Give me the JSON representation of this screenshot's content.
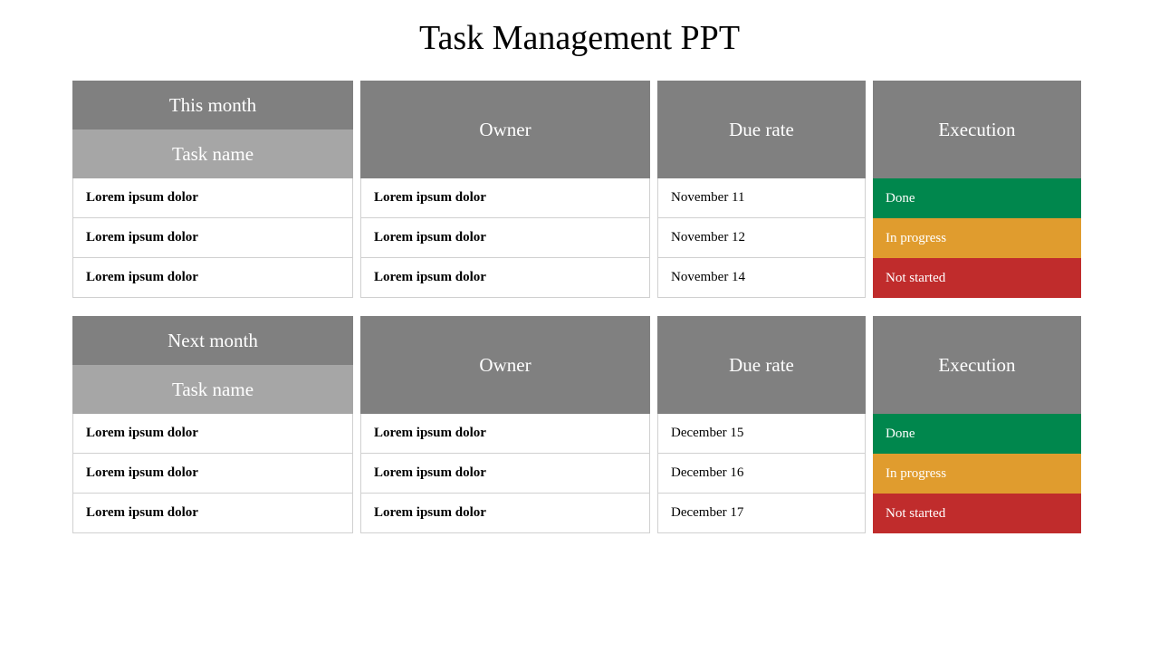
{
  "title": "Task Management PPT",
  "sections": [
    {
      "month_label": "This month",
      "taskname_label": "Task name",
      "owner_label": "Owner",
      "due_label": "Due rate",
      "exec_label": "Execution",
      "rows": [
        {
          "task": "Lorem ipsum dolor",
          "owner": "Lorem ipsum dolor",
          "due": "November 11",
          "status": "Done",
          "status_class": "done"
        },
        {
          "task": "Lorem ipsum dolor",
          "owner": "Lorem ipsum dolor",
          "due": "November 12",
          "status": "In progress",
          "status_class": "inprogress"
        },
        {
          "task": "Lorem ipsum dolor",
          "owner": "Lorem ipsum dolor",
          "due": "November 14",
          "status": "Not started",
          "status_class": "notstarted"
        }
      ]
    },
    {
      "month_label": "Next month",
      "taskname_label": "Task name",
      "owner_label": "Owner",
      "due_label": "Due rate",
      "exec_label": "Execution",
      "rows": [
        {
          "task": "Lorem ipsum dolor",
          "owner": "Lorem ipsum dolor",
          "due": "December 15",
          "status": "Done",
          "status_class": "done"
        },
        {
          "task": "Lorem ipsum dolor",
          "owner": "Lorem ipsum dolor",
          "due": "December 16",
          "status": "In progress",
          "status_class": "inprogress"
        },
        {
          "task": "Lorem ipsum dolor",
          "owner": "Lorem ipsum dolor",
          "due": "December 17",
          "status": "Not started",
          "status_class": "notstarted"
        }
      ]
    }
  ]
}
